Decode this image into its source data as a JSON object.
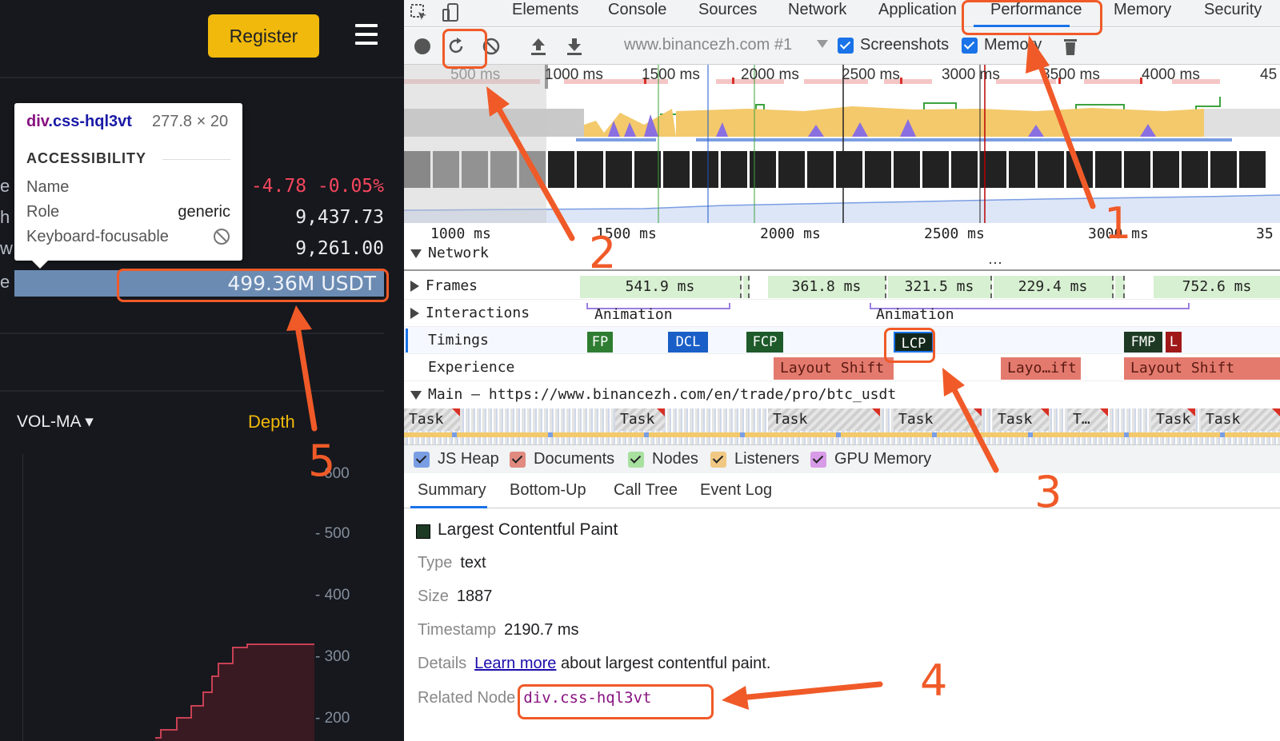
{
  "left": {
    "register_label": "Register",
    "stats": [
      {
        "letter": "e",
        "value": "-4.78 -0.05%"
      },
      {
        "letter": "h",
        "value": "9,437.73"
      },
      {
        "letter": "w",
        "value": "9,261.00"
      },
      {
        "letter": "e",
        "value": ""
      }
    ],
    "volume_bar_text": "499.36M USDT",
    "vol_ma_label": "VOL-MA",
    "depth_label": "Depth",
    "depth_axis": [
      "600",
      "- 500",
      "- 400",
      "- 300",
      "- 200"
    ],
    "tooltip": {
      "tag": "div",
      "class": ".css-hql3vt",
      "size": "277.8 × 20",
      "heading": "ACCESSIBILITY",
      "rows": [
        {
          "key": "Name",
          "value": ""
        },
        {
          "key": "Role",
          "value": "generic"
        },
        {
          "key": "Keyboard-focusable",
          "value": ""
        }
      ]
    }
  },
  "devtools": {
    "tabs": [
      "Elements",
      "Console",
      "Sources",
      "Network",
      "Application",
      "Performance",
      "Memory",
      "Security"
    ],
    "url_select": "www.binancezh.com #1",
    "screenshots_label": "Screenshots",
    "memory_label": "Memory",
    "overview_ticks": [
      "500 ms",
      "1000 ms",
      "1500 ms",
      "2000 ms",
      "2500 ms",
      "3000 ms",
      "3500 ms",
      "4000 ms",
      "45"
    ],
    "detail_ticks": [
      "1000 ms",
      "1500 ms",
      "2000 ms",
      "2500 ms",
      "3000 ms",
      "35"
    ],
    "tracks": {
      "network": "Network",
      "frames": "Frames",
      "interactions": "Interactions",
      "timings": "Timings",
      "experience": "Experience",
      "main": "Main — https://www.binancezh.com/en/trade/pro/btc_usdt"
    },
    "frames": [
      "541.9 ms",
      "361.8 ms",
      "321.5 ms",
      "229.4 ms",
      "752.6 ms"
    ],
    "animations": [
      "Animation",
      "Animation"
    ],
    "timings": [
      "FP",
      "DCL",
      "FCP",
      "LCP",
      "FMP",
      "L"
    ],
    "layout_shifts": [
      "Layout Shift",
      "Layo…ift",
      "Layout Shift"
    ],
    "tasks": [
      "Task",
      "Task",
      "Task",
      "Task",
      "Task",
      "T…",
      "Task",
      "Task"
    ],
    "memory_checkboxes": [
      {
        "label": "JS Heap",
        "color": "#7a9ee3"
      },
      {
        "label": "Documents",
        "color": "#e08a80"
      },
      {
        "label": "Nodes",
        "color": "#a8e0a0"
      },
      {
        "label": "Listeners",
        "color": "#f0c884"
      },
      {
        "label": "GPU Memory",
        "color": "#d79be8"
      }
    ],
    "detail_tabs": [
      "Summary",
      "Bottom-Up",
      "Call Tree",
      "Event Log"
    ],
    "summary": {
      "title": "Largest Contentful Paint",
      "type_key": "Type",
      "type_val": "text",
      "size_key": "Size",
      "size_val": "1887",
      "ts_key": "Timestamp",
      "ts_val": "2190.7 ms",
      "details_key": "Details",
      "details_link": "Learn more",
      "details_rest": "about largest contentful paint.",
      "node_key": "Related Node",
      "node_val": "div.css-hql3vt"
    }
  },
  "annotations": [
    "1",
    "2",
    "3",
    "4",
    "5"
  ],
  "colors": {
    "accent": "#f05a28",
    "brand": "#f0b90b",
    "devtools_blue": "#1a73e8"
  }
}
